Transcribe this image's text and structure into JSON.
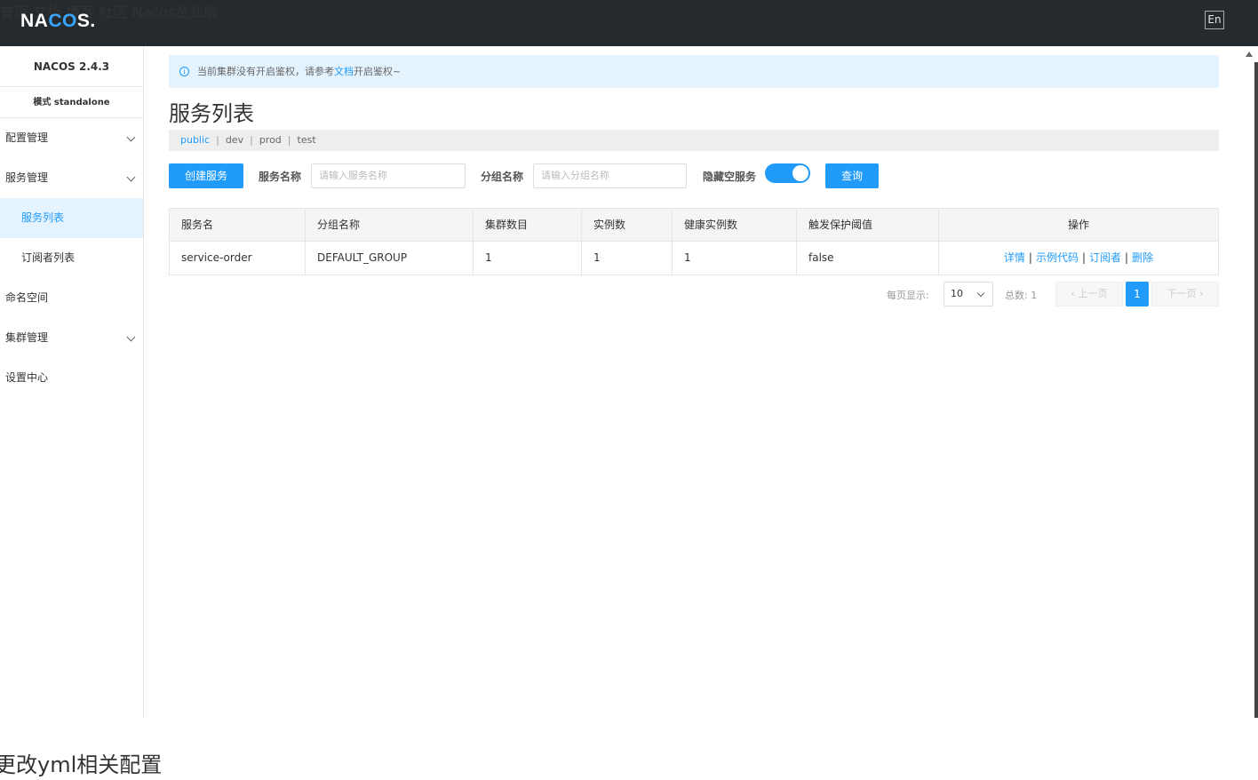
{
  "header": {
    "logo_a": "NA",
    "logo_b": "CO",
    "logo_c": "S.",
    "nav": [
      "首页",
      "文档",
      "博客",
      "社区",
      "Nacos企业版"
    ],
    "lang": "En"
  },
  "sidebar": {
    "version": "NACOS 2.4.3",
    "mode": "模式 standalone",
    "items": [
      {
        "label": "配置管理"
      },
      {
        "label": "服务管理"
      },
      {
        "label": "服务列表"
      },
      {
        "label": "订阅者列表"
      },
      {
        "label": "命名空间"
      },
      {
        "label": "集群管理"
      },
      {
        "label": "设置中心"
      }
    ]
  },
  "notice": {
    "prefix": "当前集群没有开启鉴权，请参考",
    "link": "文档",
    "suffix": "开启鉴权~"
  },
  "page_title": "服务列表",
  "namespaces": [
    "public",
    "dev",
    "prod",
    "test"
  ],
  "filters": {
    "create_button": "创建服务",
    "service_name_label": "服务名称",
    "service_name_placeholder": "请输入服务名称",
    "group_name_label": "分组名称",
    "group_name_placeholder": "请输入分组名称",
    "hide_empty_label": "隐藏空服务",
    "query_button": "查询"
  },
  "table": {
    "headers": [
      "服务名",
      "分组名称",
      "集群数目",
      "实例数",
      "健康实例数",
      "触发保护阈值",
      "操作"
    ],
    "rows": [
      [
        "service-order",
        "DEFAULT_GROUP",
        "1",
        "1",
        "1",
        "false"
      ]
    ],
    "actions": [
      "详情",
      "示例代码",
      "订阅者",
      "删除"
    ]
  },
  "pagination": {
    "per_page_label": "每页显示:",
    "per_page_value": "10",
    "total_label": "总数:",
    "total_value": "1",
    "prev": "上一页",
    "current": "1",
    "next": "下一页"
  },
  "bottom_text": "更改yml相关配置",
  "colors": {
    "accent": "#209bfa",
    "topbar": "#252a2f"
  }
}
